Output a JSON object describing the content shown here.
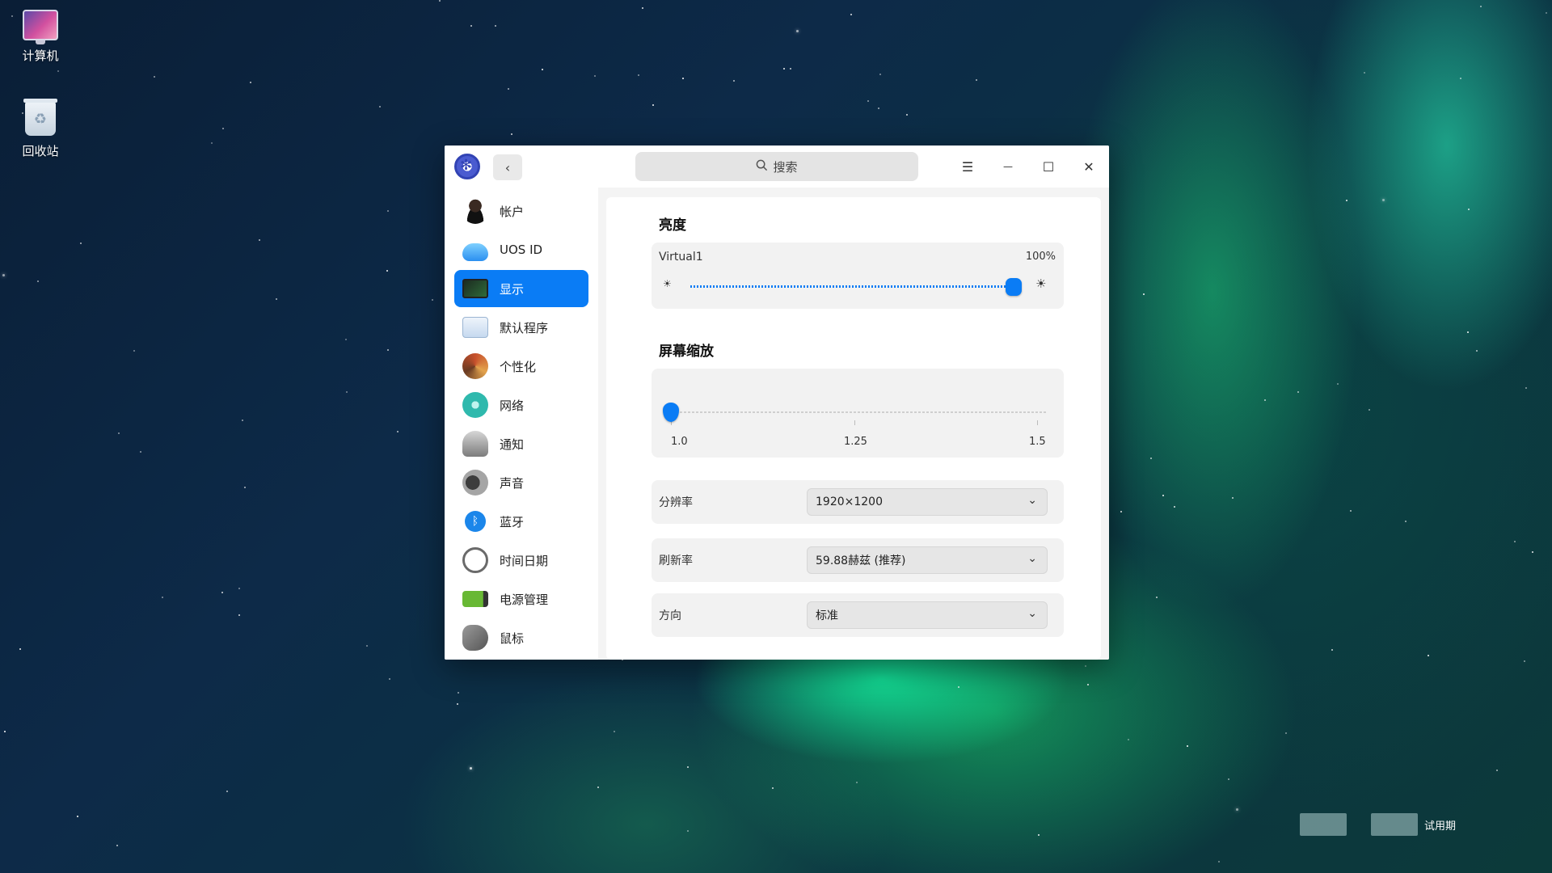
{
  "desktop": {
    "icons": [
      {
        "label": "计算机",
        "icon": "computer-icon"
      },
      {
        "label": "回收站",
        "icon": "trash-icon"
      }
    ],
    "watermark": {
      "text": "试用期"
    }
  },
  "window": {
    "titlebar": {
      "back_icon": "‹",
      "search_placeholder": "搜索",
      "menu_icon": "☰",
      "minimize_icon": "—",
      "maximize_icon": "☐",
      "close_icon": "✕"
    },
    "sidebar": {
      "items": [
        {
          "label": "帐户",
          "icon": "account-icon"
        },
        {
          "label": "UOS ID",
          "icon": "cloud-icon"
        },
        {
          "label": "显示",
          "icon": "display-icon",
          "active": true
        },
        {
          "label": "默认程序",
          "icon": "default-apps-icon"
        },
        {
          "label": "个性化",
          "icon": "personalization-icon"
        },
        {
          "label": "网络",
          "icon": "network-icon"
        },
        {
          "label": "通知",
          "icon": "notification-icon"
        },
        {
          "label": "声音",
          "icon": "sound-icon"
        },
        {
          "label": "蓝牙",
          "icon": "bluetooth-icon"
        },
        {
          "label": "时间日期",
          "icon": "clock-icon"
        },
        {
          "label": "电源管理",
          "icon": "power-icon"
        },
        {
          "label": "鼠标",
          "icon": "mouse-icon"
        }
      ]
    },
    "brightness": {
      "title": "亮度",
      "monitor": "Virtual1",
      "value_text": "100%",
      "value": 1.0
    },
    "scaling": {
      "title": "屏幕缩放",
      "ticks": [
        "1.0",
        "1.25",
        "1.5"
      ],
      "value": 1.0
    },
    "settings": [
      {
        "label": "分辨率",
        "value": "1920×1200"
      },
      {
        "label": "刷新率",
        "value": "59.88赫兹 (推荐)"
      },
      {
        "label": "方向",
        "value": "标准"
      }
    ]
  }
}
